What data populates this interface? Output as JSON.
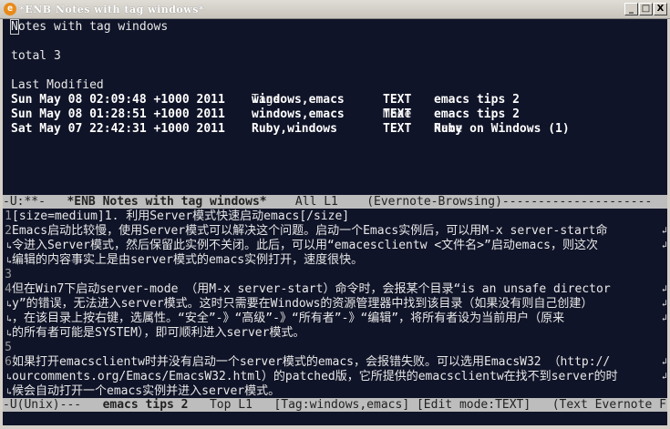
{
  "window": {
    "title": "*ENB Notes with tag windows*",
    "buttons": [
      "_",
      "□",
      "X"
    ]
  },
  "top": {
    "heading": "Notes with tag windows",
    "total": "total 3",
    "columns": {
      "modified": "Last Modified",
      "tags": "Tags",
      "mode": "Mode",
      "name": "Name"
    },
    "rows": [
      {
        "modified": "Sun May 08 02:09:48 +1000 2011",
        "tags": "windows,emacs",
        "mode": "TEXT",
        "name": "emacs tips 2"
      },
      {
        "modified": "Sun May 08 01:28:51 +1000 2011",
        "tags": "windows,emacs",
        "mode": "TEXT",
        "name": "emacs tips 2"
      },
      {
        "modified": "Sat May 07 22:42:31 +1000 2011",
        "tags": "Ruby,windows",
        "mode": "TEXT",
        "name": "Ruby on Windows (1)"
      }
    ]
  },
  "modeline1": {
    "state": "-U:**-",
    "buffer": "*ENB Notes with tag windows*",
    "pos": "All L1",
    "mode": "(Evernote-Browsing)---------------------"
  },
  "bottom": {
    "lines": [
      {
        "num": "1",
        "text": "[size=medium]1. 利用Server模式快速启动emacs[/size]"
      },
      {
        "num": "2",
        "text": "Emacs启动比较慢，使用Server模式可以解决这个问题。启动一个Emacs实例后，可以用M-x server-start命"
      },
      {
        "num": "",
        "text": "令进入Server模式，然后保留此实例不关闭。此后，可以用“emacesclientw <文件名>”启动emacs，则这次"
      },
      {
        "num": "",
        "text": "编辑的内容事实上是由server模式的emacs实例打开，速度很快。"
      },
      {
        "num": "3",
        "text": ""
      },
      {
        "num": "4",
        "text": "但在Win7下启动server-mode （用M-x server-start）命令时，会报某个目录“is an unsafe director"
      },
      {
        "num": "",
        "text": "y”的错误，无法进入server模式。这时只需要在Windows的资源管理器中找到该目录（如果没有则自己创建）"
      },
      {
        "num": "",
        "text": "，在该目录上按右键，选属性。“安全”-》“高级”-》“所有者”-》“编辑”，将所有者设为当前用户（原来"
      },
      {
        "num": "",
        "text": "的所有者可能是SYSTEM），即可顺利进入server模式。"
      },
      {
        "num": "5",
        "text": ""
      },
      {
        "num": "6",
        "text": "如果打开emacsclientw时并没有启动一个server模式的emacs，会报错失败。可以选用EmacsW32 （http://"
      },
      {
        "num": "",
        "text": "ourcomments.org/Emacs/EmacsW32.html）的patched版，它所提供的emacsclientw在找不到server的时"
      },
      {
        "num": "",
        "text": "候会自动打开一个emacs实例并进入server模式。"
      }
    ]
  },
  "modeline2": {
    "state": "-U(Unix)---",
    "buffer": "emacs tips 2",
    "pos": "Top L1",
    "tag": "[Tag:windows,emacs]",
    "editmode": "[Edit mode:TEXT]",
    "mode": "(Text Evernote F"
  }
}
